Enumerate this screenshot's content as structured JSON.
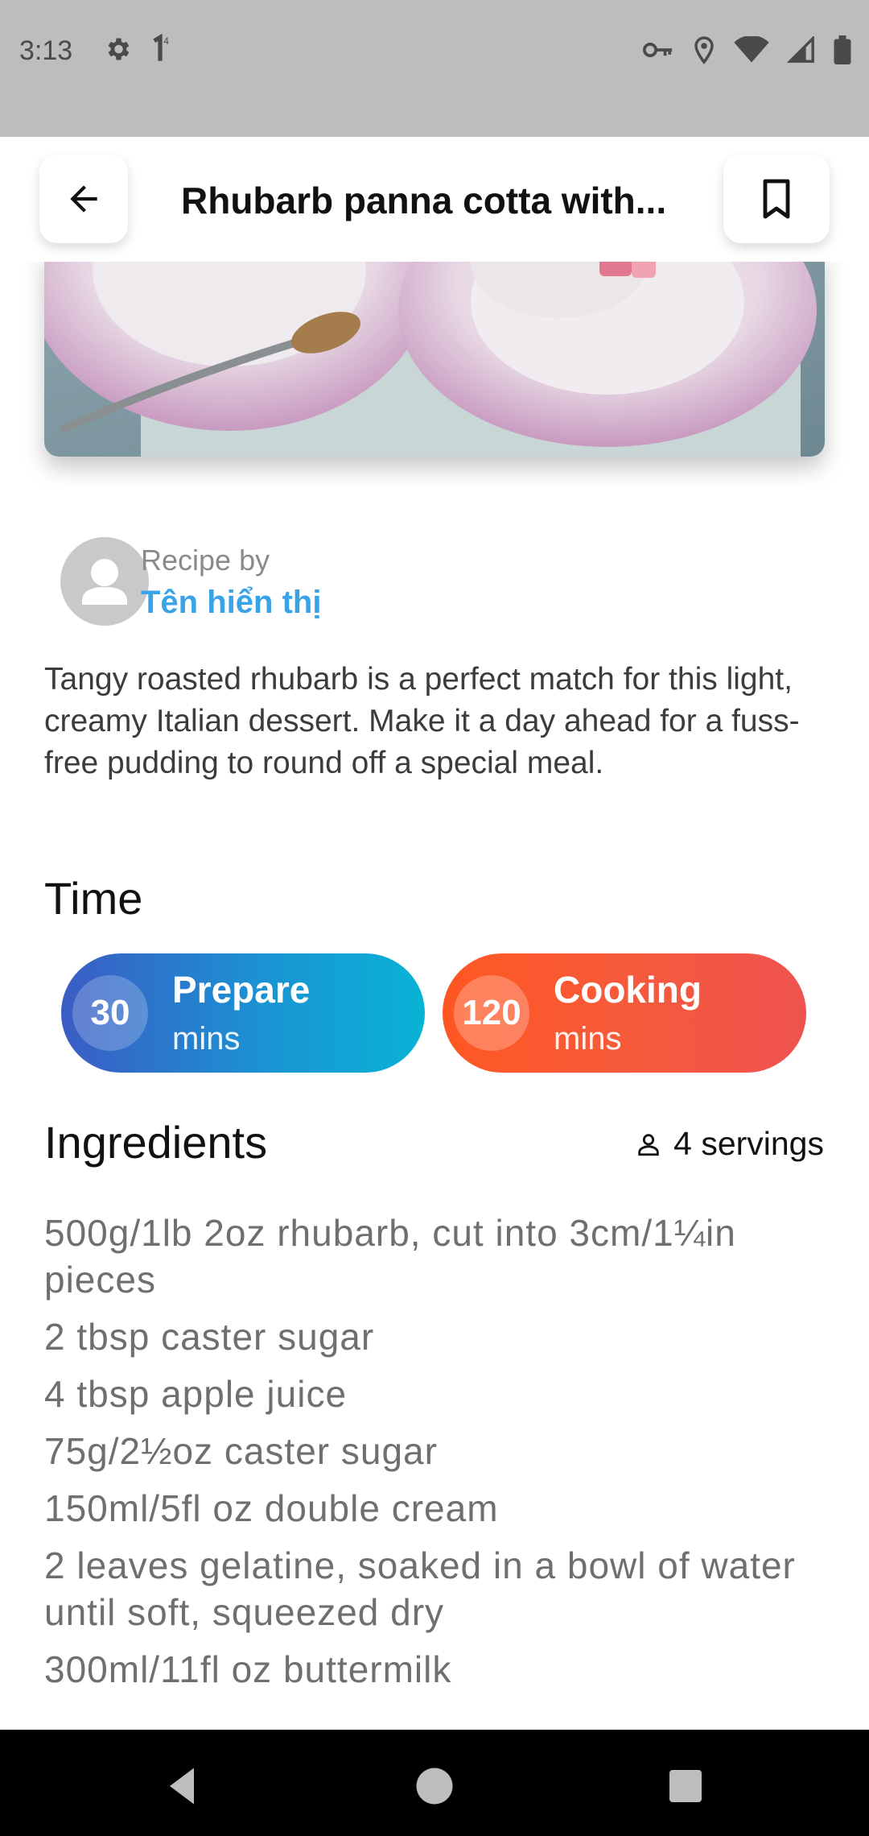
{
  "status_bar": {
    "time": "3:13"
  },
  "app_bar": {
    "title": "Rhubarb panna cotta with..."
  },
  "author": {
    "recipe_by_label": "Recipe by",
    "name": "Tên hiển thị"
  },
  "description": "Tangy roasted rhubarb is a perfect match for this light, creamy Italian dessert. Make it a day ahead for a fuss-free pudding to round off a special meal.",
  "time": {
    "heading": "Time",
    "prepare": {
      "value": "30",
      "label": "Prepare",
      "unit": "mins"
    },
    "cooking": {
      "value": "120",
      "label": "Cooking",
      "unit": "mins"
    }
  },
  "ingredients": {
    "heading": "Ingredients",
    "servings": "4 servings",
    "items": [
      "500g/1lb 2oz rhubarb, cut into 3cm/1¼in pieces",
      "2 tbsp caster sugar",
      "4 tbsp apple juice",
      "75g/2½oz caster sugar",
      "150ml/5fl oz double cream",
      "2 leaves gelatine, soaked in a bowl of water until soft, squeezed dry",
      "300ml/11fl oz buttermilk"
    ]
  },
  "colors": {
    "author_link": "#3aa3e8",
    "prepare_gradient_start": "#3b5cc4",
    "prepare_gradient_end": "#08b3d4",
    "cooking_gradient_start": "#ff5722",
    "cooking_gradient_end": "#ef5350"
  }
}
